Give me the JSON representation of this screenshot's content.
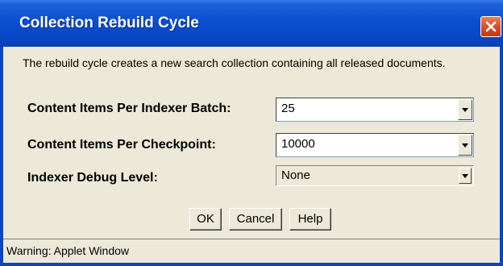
{
  "window": {
    "title": "Collection Rebuild Cycle"
  },
  "description": "The rebuild cycle creates a new search collection containing all released documents.",
  "fields": {
    "batch": {
      "label": "Content Items Per Indexer Batch:",
      "value": "25"
    },
    "checkpoint": {
      "label": "Content Items Per Checkpoint:",
      "value": "10000"
    },
    "debug_level": {
      "label": "Indexer Debug Level:",
      "value": "None"
    }
  },
  "buttons": {
    "ok": "OK",
    "cancel": "Cancel",
    "help": "Help"
  },
  "status_bar": {
    "text": "Warning: Applet Window"
  },
  "colors": {
    "titlebar": "#0846c4",
    "close_button": "#d8502a",
    "dialog_background": "#ece9d8"
  },
  "icons": {
    "close": "close-icon",
    "dropdown": "chevron-down-icon"
  }
}
